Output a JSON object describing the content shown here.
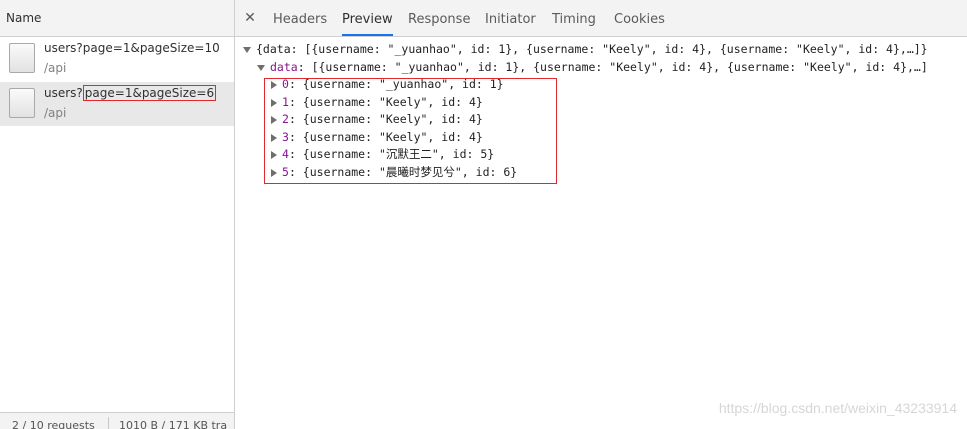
{
  "request_list": {
    "header": "Name",
    "requests": [
      {
        "name": "users?page=1&pageSize=10",
        "path": "/api"
      },
      {
        "name_prefix": "users?",
        "name_query": "page=1&pageSize=6",
        "path": "/api"
      }
    ],
    "status": {
      "requests": "2 / 10 requests",
      "size": "1010 B / 171 KB tra"
    }
  },
  "detail": {
    "close_icon": "close-icon",
    "tabs": [
      {
        "label": "Headers"
      },
      {
        "label": "Preview",
        "active": true
      },
      {
        "label": "Response"
      },
      {
        "label": "Initiator"
      },
      {
        "label": "Timing"
      },
      {
        "label": "Cookies"
      }
    ],
    "preview": {
      "root_summary": "{data: [{username: \"_yuanhao\", id: 1}, {username: \"Keely\", id: 4}, {username: \"Keely\", id: 4},…]}",
      "data_key": "data",
      "data_summary": "[{username: \"_yuanhao\", id: 1}, {username: \"Keely\", id: 4}, {username: \"Keely\", id: 4},…]",
      "items": [
        {
          "index": "0",
          "text": "{username: \"_yuanhao\", id: 1}"
        },
        {
          "index": "1",
          "text": "{username: \"Keely\", id: 4}"
        },
        {
          "index": "2",
          "text": "{username: \"Keely\", id: 4}"
        },
        {
          "index": "3",
          "text": "{username: \"Keely\", id: 4}"
        },
        {
          "index": "4",
          "text": "{username: \"沉默王二\", id: 5}"
        },
        {
          "index": "5",
          "text": "{username: \"晨曦时梦见兮\", id: 6}"
        }
      ]
    }
  },
  "watermark": "https://blog.csdn.net/weixin_43233914",
  "colors": {
    "highlight_box": "#e0282e",
    "active_tab_underline": "#1a73e8",
    "selected_row": "#e8e8e8"
  }
}
